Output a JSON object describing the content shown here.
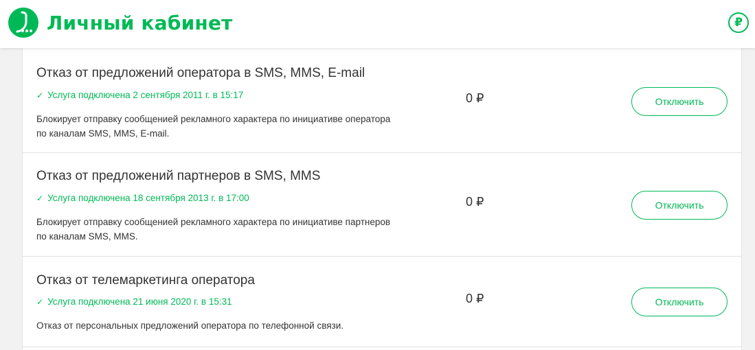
{
  "header": {
    "title": "Личный кабинет",
    "brand_color": "#00b956",
    "logo_icon": "megafon-logo",
    "balance_icon": "ruble-icon",
    "balance_symbol": "₽"
  },
  "services": [
    {
      "name": "Отказ от предложений оператора в SMS, MMS, E-mail",
      "status": "Услуга подключена 2 сентября 2011 г. в 15:17",
      "description": "Блокирует отправку сообщенией рекламного характера по инициативе оператора по каналам SMS, MMS, E-mail.",
      "price": "0 ₽",
      "button": "Отключить"
    },
    {
      "name": "Отказ от предложений партнеров в SMS, MMS",
      "status": "Услуга подключена 18 сентября 2013 г. в 17:00",
      "description": "Блокирует отправку сообщенией рекламного характера по инициативе партнеров по каналам SMS, MMS.",
      "price": "0 ₽",
      "button": "Отключить"
    },
    {
      "name": "Отказ от телемаркетинга оператора",
      "status": "Услуга подключена 21 июня 2020 г. в 15:31",
      "description": "Отказ от персональных предложений оператора по телефонной связи.",
      "price": "0 ₽",
      "button": "Отключить"
    }
  ]
}
